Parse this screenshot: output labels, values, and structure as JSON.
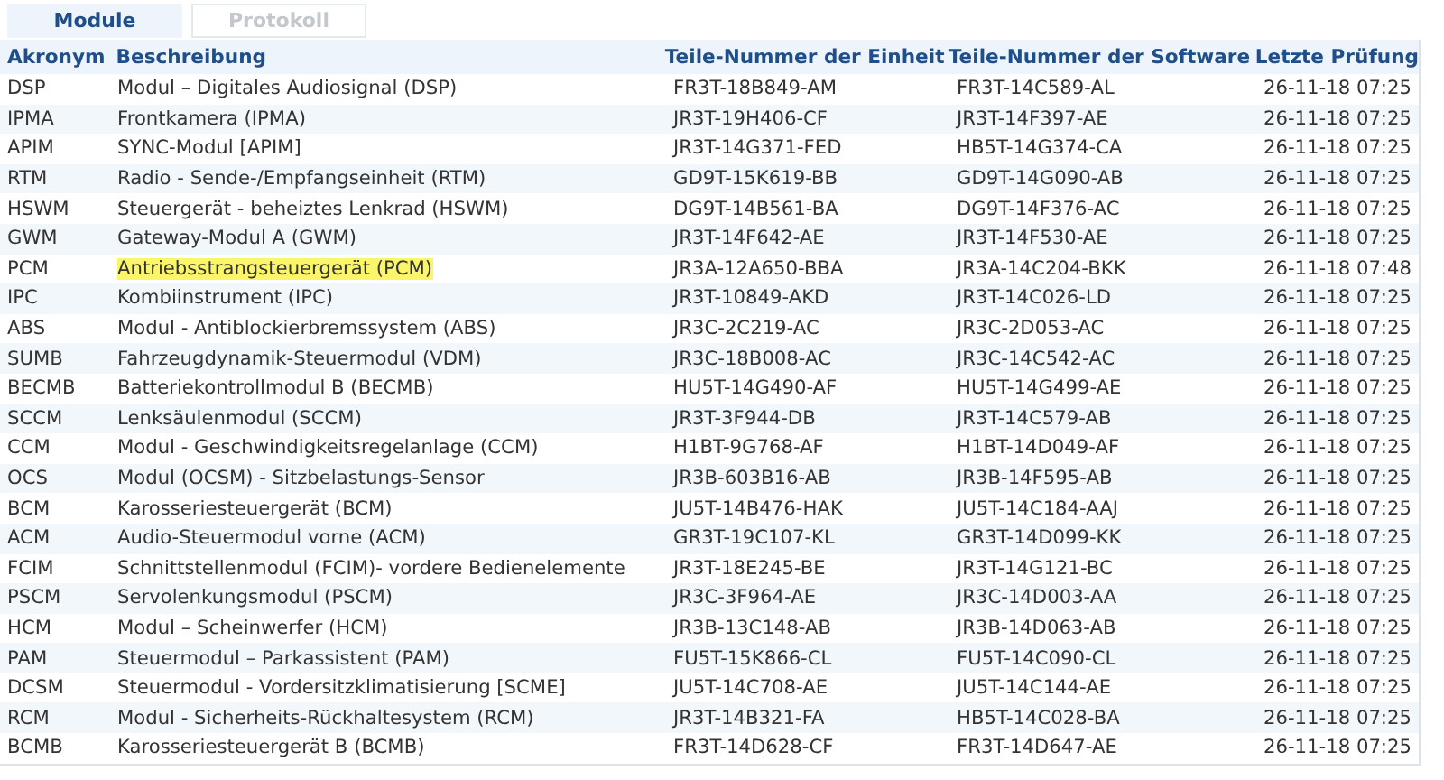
{
  "tabs": [
    {
      "label": "Module",
      "selected": true
    },
    {
      "label": "Protokoll",
      "selected": false
    }
  ],
  "table": {
    "columns": [
      "Akronym",
      "Beschreibung",
      "Teile-Nummer der Einheit",
      "Teile-Nummer der Software",
      "Letzte Prüfung"
    ],
    "rows": [
      {
        "cells": [
          "DSP",
          "Modul – Digitales Audiosignal (DSP)",
          "FR3T-18B849-AM",
          "FR3T-14C589-AL",
          "26-11-18 07:25"
        ],
        "highlighted": false
      },
      {
        "cells": [
          "IPMA",
          "Frontkamera (IPMA)",
          "JR3T-19H406-CF",
          "JR3T-14F397-AE",
          "26-11-18 07:25"
        ],
        "highlighted": false
      },
      {
        "cells": [
          "APIM",
          "SYNC-Modul [APIM]",
          "JR3T-14G371-FED",
          "HB5T-14G374-CA",
          "26-11-18 07:25"
        ],
        "highlighted": false
      },
      {
        "cells": [
          "RTM",
          "Radio - Sende-/Empfangseinheit (RTM)",
          "GD9T-15K619-BB",
          "GD9T-14G090-AB",
          "26-11-18 07:25"
        ],
        "highlighted": false
      },
      {
        "cells": [
          "HSWM",
          "Steuergerät - beheiztes Lenkrad (HSWM)",
          "DG9T-14B561-BA",
          "DG9T-14F376-AC",
          "26-11-18 07:25"
        ],
        "highlighted": false
      },
      {
        "cells": [
          "GWM",
          "Gateway-Modul A (GWM)",
          "JR3T-14F642-AE",
          "JR3T-14F530-AE",
          "26-11-18 07:25"
        ],
        "highlighted": false
      },
      {
        "cells": [
          "PCM",
          "Antriebsstrangsteuergerät (PCM)",
          "JR3A-12A650-BBA",
          "JR3A-14C204-BKK",
          "26-11-18 07:48"
        ],
        "highlighted": true
      },
      {
        "cells": [
          "IPC",
          "Kombiinstrument (IPC)",
          "JR3T-10849-AKD",
          "JR3T-14C026-LD",
          "26-11-18 07:25"
        ],
        "highlighted": false
      },
      {
        "cells": [
          "ABS",
          "Modul - Antiblockierbremssystem (ABS)",
          "JR3C-2C219-AC",
          "JR3C-2D053-AC",
          "26-11-18 07:25"
        ],
        "highlighted": false
      },
      {
        "cells": [
          "SUMB",
          "Fahrzeugdynamik-Steuermodul (VDM)",
          "JR3C-18B008-AC",
          "JR3C-14C542-AC",
          "26-11-18 07:25"
        ],
        "highlighted": false
      },
      {
        "cells": [
          "BECMB",
          "Batteriekontrollmodul B (BECMB)",
          "HU5T-14G490-AF",
          "HU5T-14G499-AE",
          "26-11-18 07:25"
        ],
        "highlighted": false
      },
      {
        "cells": [
          "SCCM",
          "Lenksäulenmodul (SCCM)",
          "JR3T-3F944-DB",
          "JR3T-14C579-AB",
          "26-11-18 07:25"
        ],
        "highlighted": false
      },
      {
        "cells": [
          "CCM",
          "Modul - Geschwindigkeitsregelanlage (CCM)",
          "H1BT-9G768-AF",
          "H1BT-14D049-AF",
          "26-11-18 07:25"
        ],
        "highlighted": false
      },
      {
        "cells": [
          "OCS",
          "Modul (OCSM) - Sitzbelastungs-Sensor",
          "JR3B-603B16-AB",
          "JR3B-14F595-AB",
          "26-11-18 07:25"
        ],
        "highlighted": false
      },
      {
        "cells": [
          "BCM",
          "Karosseriesteuergerät (BCM)",
          "JU5T-14B476-HAK",
          "JU5T-14C184-AAJ",
          "26-11-18 07:25"
        ],
        "highlighted": false
      },
      {
        "cells": [
          "ACM",
          "Audio-Steuermodul vorne (ACM)",
          "GR3T-19C107-KL",
          "GR3T-14D099-KK",
          "26-11-18 07:25"
        ],
        "highlighted": false
      },
      {
        "cells": [
          "FCIM",
          "Schnittstellenmodul (FCIM)- vordere Bedienelemente",
          "JR3T-18E245-BE",
          "JR3T-14G121-BC",
          "26-11-18 07:25"
        ],
        "highlighted": false
      },
      {
        "cells": [
          "PSCM",
          "Servolenkungsmodul (PSCM)",
          "JR3C-3F964-AE",
          "JR3C-14D003-AA",
          "26-11-18 07:25"
        ],
        "highlighted": false
      },
      {
        "cells": [
          "HCM",
          "Modul – Scheinwerfer (HCM)",
          "JR3B-13C148-AB",
          "JR3B-14D063-AB",
          "26-11-18 07:25"
        ],
        "highlighted": false
      },
      {
        "cells": [
          "PAM",
          "Steuermodul – Parkassistent (PAM)",
          "FU5T-15K866-CL",
          "FU5T-14C090-CL",
          "26-11-18 07:25"
        ],
        "highlighted": false
      },
      {
        "cells": [
          "DCSM",
          "Steuermodul - Vordersitzklimatisierung [SCME]",
          "JU5T-14C708-AE",
          "JU5T-14C144-AE",
          "26-11-18 07:25"
        ],
        "highlighted": false
      },
      {
        "cells": [
          "RCM",
          "Modul - Sicherheits-Rückhaltesystem (RCM)",
          "JR3T-14B321-FA",
          "HB5T-14C028-BA",
          "26-11-18 07:25"
        ],
        "highlighted": false
      },
      {
        "cells": [
          "BCMB",
          "Karosseriesteuergerät B (BCMB)",
          "FR3T-14D628-CF",
          "FR3T-14D647-AE",
          "26-11-18 07:25"
        ],
        "highlighted": false
      }
    ]
  }
}
